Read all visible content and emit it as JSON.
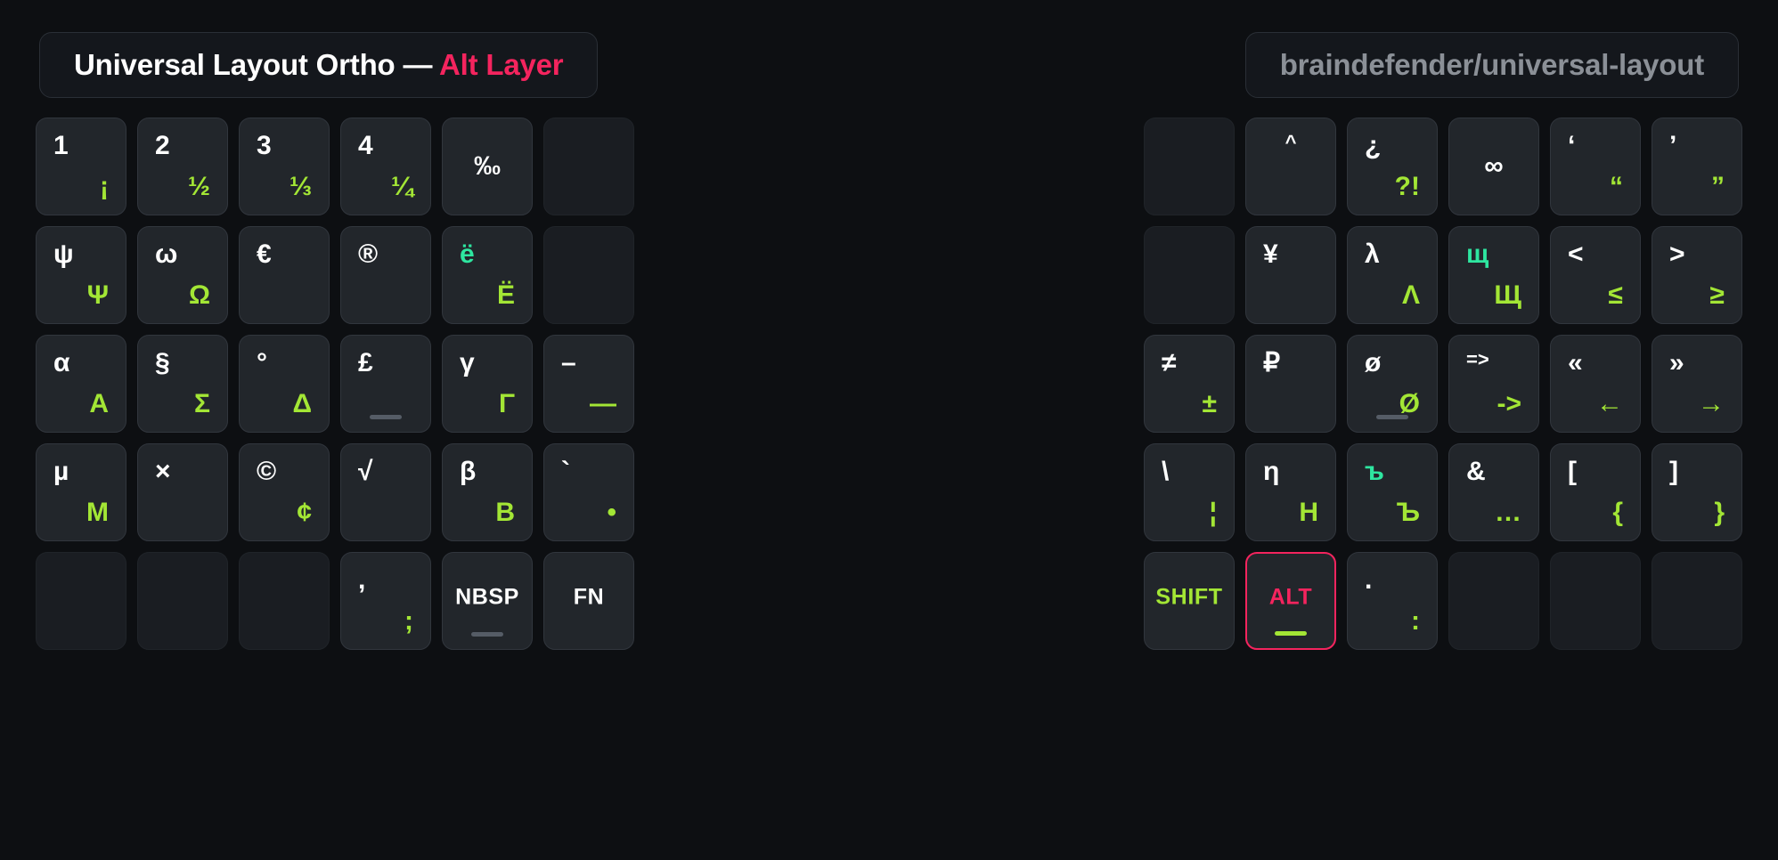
{
  "header": {
    "title_main": "Universal Layout Ortho — ",
    "title_accent": "Alt Layer",
    "repo": "braindefender/universal-layout"
  },
  "colors": {
    "background": "#0d0f12",
    "key_face": "#22262b",
    "key_border": "#31363d",
    "accent_pink": "#f4245e",
    "lime": "#a3e635",
    "teal": "#2ee6a0",
    "white": "#ffffff",
    "muted": "#8b9097"
  },
  "keyboard": {
    "left": [
      [
        {
          "top": "1",
          "bottom": "¡"
        },
        {
          "top": "2",
          "bottom": "½"
        },
        {
          "top": "3",
          "bottom": "⅓"
        },
        {
          "top": "4",
          "bottom": "¼"
        },
        {
          "center": "‰"
        },
        {
          "empty": true
        }
      ],
      [
        {
          "top": "ψ",
          "bottom": "Ψ"
        },
        {
          "top": "ω",
          "bottom": "Ω"
        },
        {
          "center_left": "€"
        },
        {
          "center_left": "®"
        },
        {
          "top": "ë",
          "bottom": "Ë",
          "top_color": "teal"
        },
        {
          "empty": true
        }
      ],
      [
        {
          "top": "α",
          "bottom": "A"
        },
        {
          "top": "§",
          "bottom": "Σ"
        },
        {
          "top": "°",
          "bottom": "Δ"
        },
        {
          "center_left": "£",
          "homing": true
        },
        {
          "top": "γ",
          "bottom": "Γ"
        },
        {
          "top": "–",
          "bottom": "—"
        }
      ],
      [
        {
          "top": "µ",
          "bottom": "M"
        },
        {
          "center_left": "×"
        },
        {
          "top": "©",
          "bottom": "¢"
        },
        {
          "center_left": "√"
        },
        {
          "top": "β",
          "bottom": "B"
        },
        {
          "top": "`",
          "bottom": "•"
        }
      ],
      [
        {
          "empty": true
        },
        {
          "empty": true
        },
        {
          "empty": true
        },
        {
          "top": ",",
          "bottom": ";"
        },
        {
          "label": "NBSP",
          "homing": true
        },
        {
          "label": "FN"
        }
      ]
    ],
    "right": [
      [
        {
          "empty": true
        },
        {
          "center_top": "^"
        },
        {
          "top": "¿",
          "bottom": "?!"
        },
        {
          "center": "∞"
        },
        {
          "top": "‘",
          "bottom": "“"
        },
        {
          "top": "’",
          "bottom": "”"
        }
      ],
      [
        {
          "empty": true
        },
        {
          "center_left": "¥"
        },
        {
          "top": "λ",
          "bottom": "Λ"
        },
        {
          "top": "щ",
          "bottom": "Щ",
          "top_color": "teal"
        },
        {
          "top": "<",
          "bottom": "≤"
        },
        {
          "top": ">",
          "bottom": "≥"
        }
      ],
      [
        {
          "top": "≠",
          "bottom": "±"
        },
        {
          "center_left": "₽"
        },
        {
          "top": "ø",
          "bottom": "Ø",
          "homing": true
        },
        {
          "top": "=>",
          "bottom": "->"
        },
        {
          "top": "«",
          "bottom": "←"
        },
        {
          "top": "»",
          "bottom": "→"
        }
      ],
      [
        {
          "top": "\\",
          "bottom": "¦"
        },
        {
          "top": "η",
          "bottom": "H"
        },
        {
          "top": "ъ",
          "bottom": "Ъ",
          "top_color": "teal"
        },
        {
          "top": "&",
          "bottom": "…"
        },
        {
          "top": "[",
          "bottom": "{"
        },
        {
          "top": "]",
          "bottom": "}"
        }
      ],
      [
        {
          "label": "SHIFT",
          "label_color": "lime"
        },
        {
          "label": "ALT",
          "label_color": "accent",
          "highlight": true,
          "homing_lime": true
        },
        {
          "top": ".",
          "bottom": ":"
        },
        {
          "empty": true
        },
        {
          "empty": true
        },
        {
          "empty": true
        }
      ]
    ]
  }
}
